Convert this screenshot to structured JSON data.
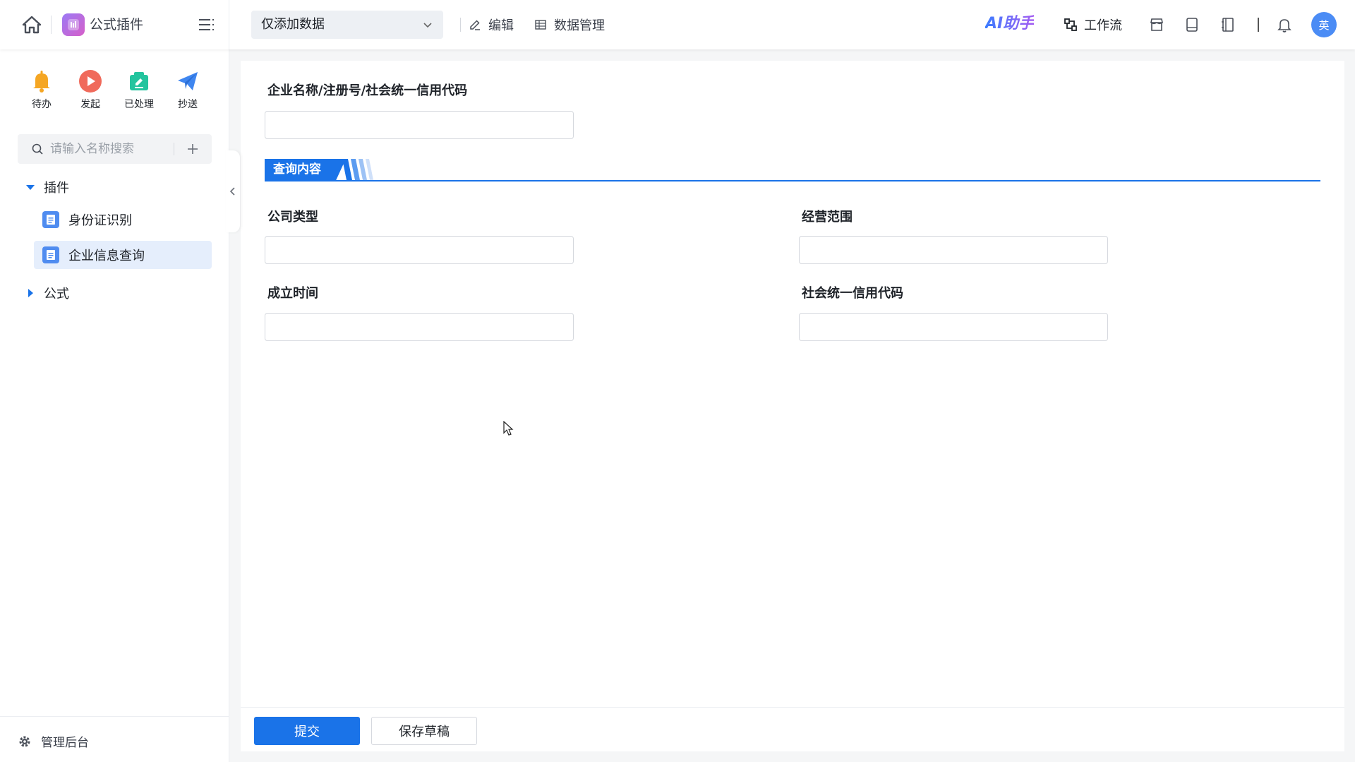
{
  "topbar": {
    "app_title": "公式插件",
    "view_select": {
      "value": "仅添加数据"
    },
    "edit_label": "编辑",
    "data_manage_label": "数据管理",
    "ai_label": "AI助手",
    "workflow_label": "工作流",
    "avatar_text": "英"
  },
  "sidebar": {
    "quick_actions": [
      {
        "label": "待办",
        "icon": "bell-icon",
        "color": "#f5a623"
      },
      {
        "label": "发起",
        "icon": "play-icon",
        "color": "#f06a5b"
      },
      {
        "label": "已处理",
        "icon": "edit-icon",
        "color": "#23c49e"
      },
      {
        "label": "抄送",
        "icon": "send-icon",
        "color": "#3f86f0"
      }
    ],
    "search": {
      "placeholder": "请输入名称搜索"
    },
    "tree": {
      "groups": [
        {
          "label": "插件",
          "expanded": true,
          "items": [
            {
              "label": "身份证识别",
              "active": false
            },
            {
              "label": "企业信息查询",
              "active": true
            }
          ]
        },
        {
          "label": "公式",
          "expanded": false
        }
      ]
    },
    "footer": {
      "admin_label": "管理后台"
    }
  },
  "form": {
    "company_query_label": "企业名称/注册号/社会统一信用代码",
    "section_title": "查询内容",
    "fields": {
      "company_type": "公司类型",
      "business_scope": "经营范围",
      "established_date": "成立时间",
      "credit_code": "社会统一信用代码"
    },
    "submit_label": "提交",
    "draft_label": "保存草稿"
  },
  "colors": {
    "primary": "#1a73e8",
    "active_bg": "#e5eefc"
  }
}
